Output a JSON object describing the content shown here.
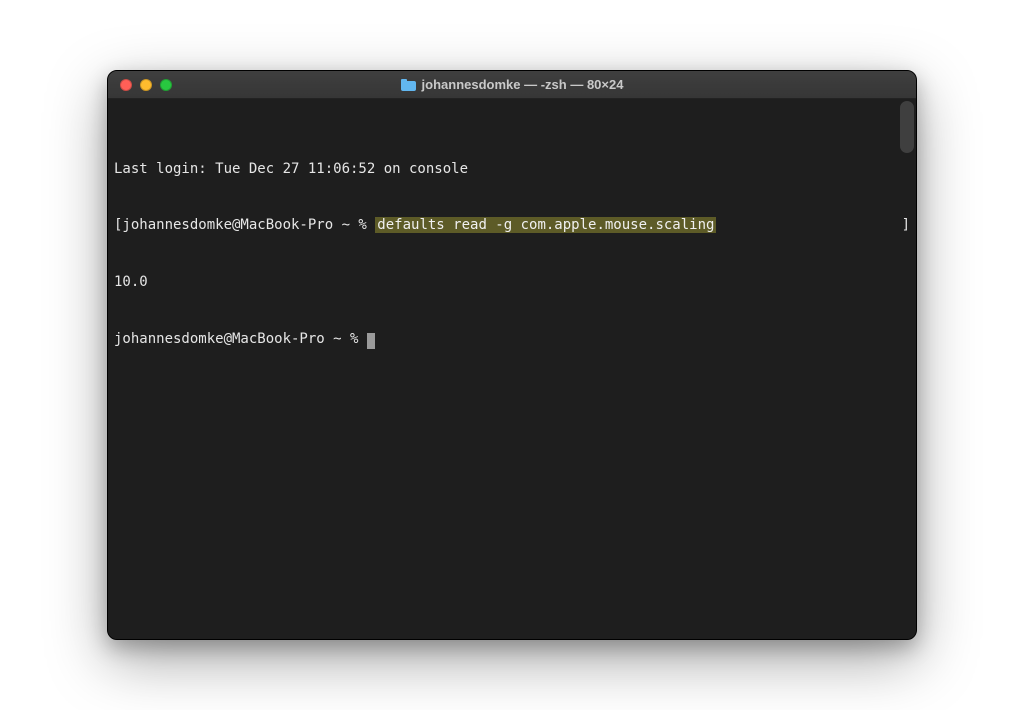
{
  "window": {
    "title": "johannesdomke — -zsh — 80×24"
  },
  "terminal": {
    "last_login": "Last login: Tue Dec 27 11:06:52 on console",
    "prompt1_prefix": "[johannesdomke@MacBook-Pro ~ % ",
    "command_highlighted": "defaults read -g com.apple.mouse.scaling",
    "bracket_right": "]",
    "output": "10.0",
    "prompt2": "johannesdomke@MacBook-Pro ~ % "
  }
}
